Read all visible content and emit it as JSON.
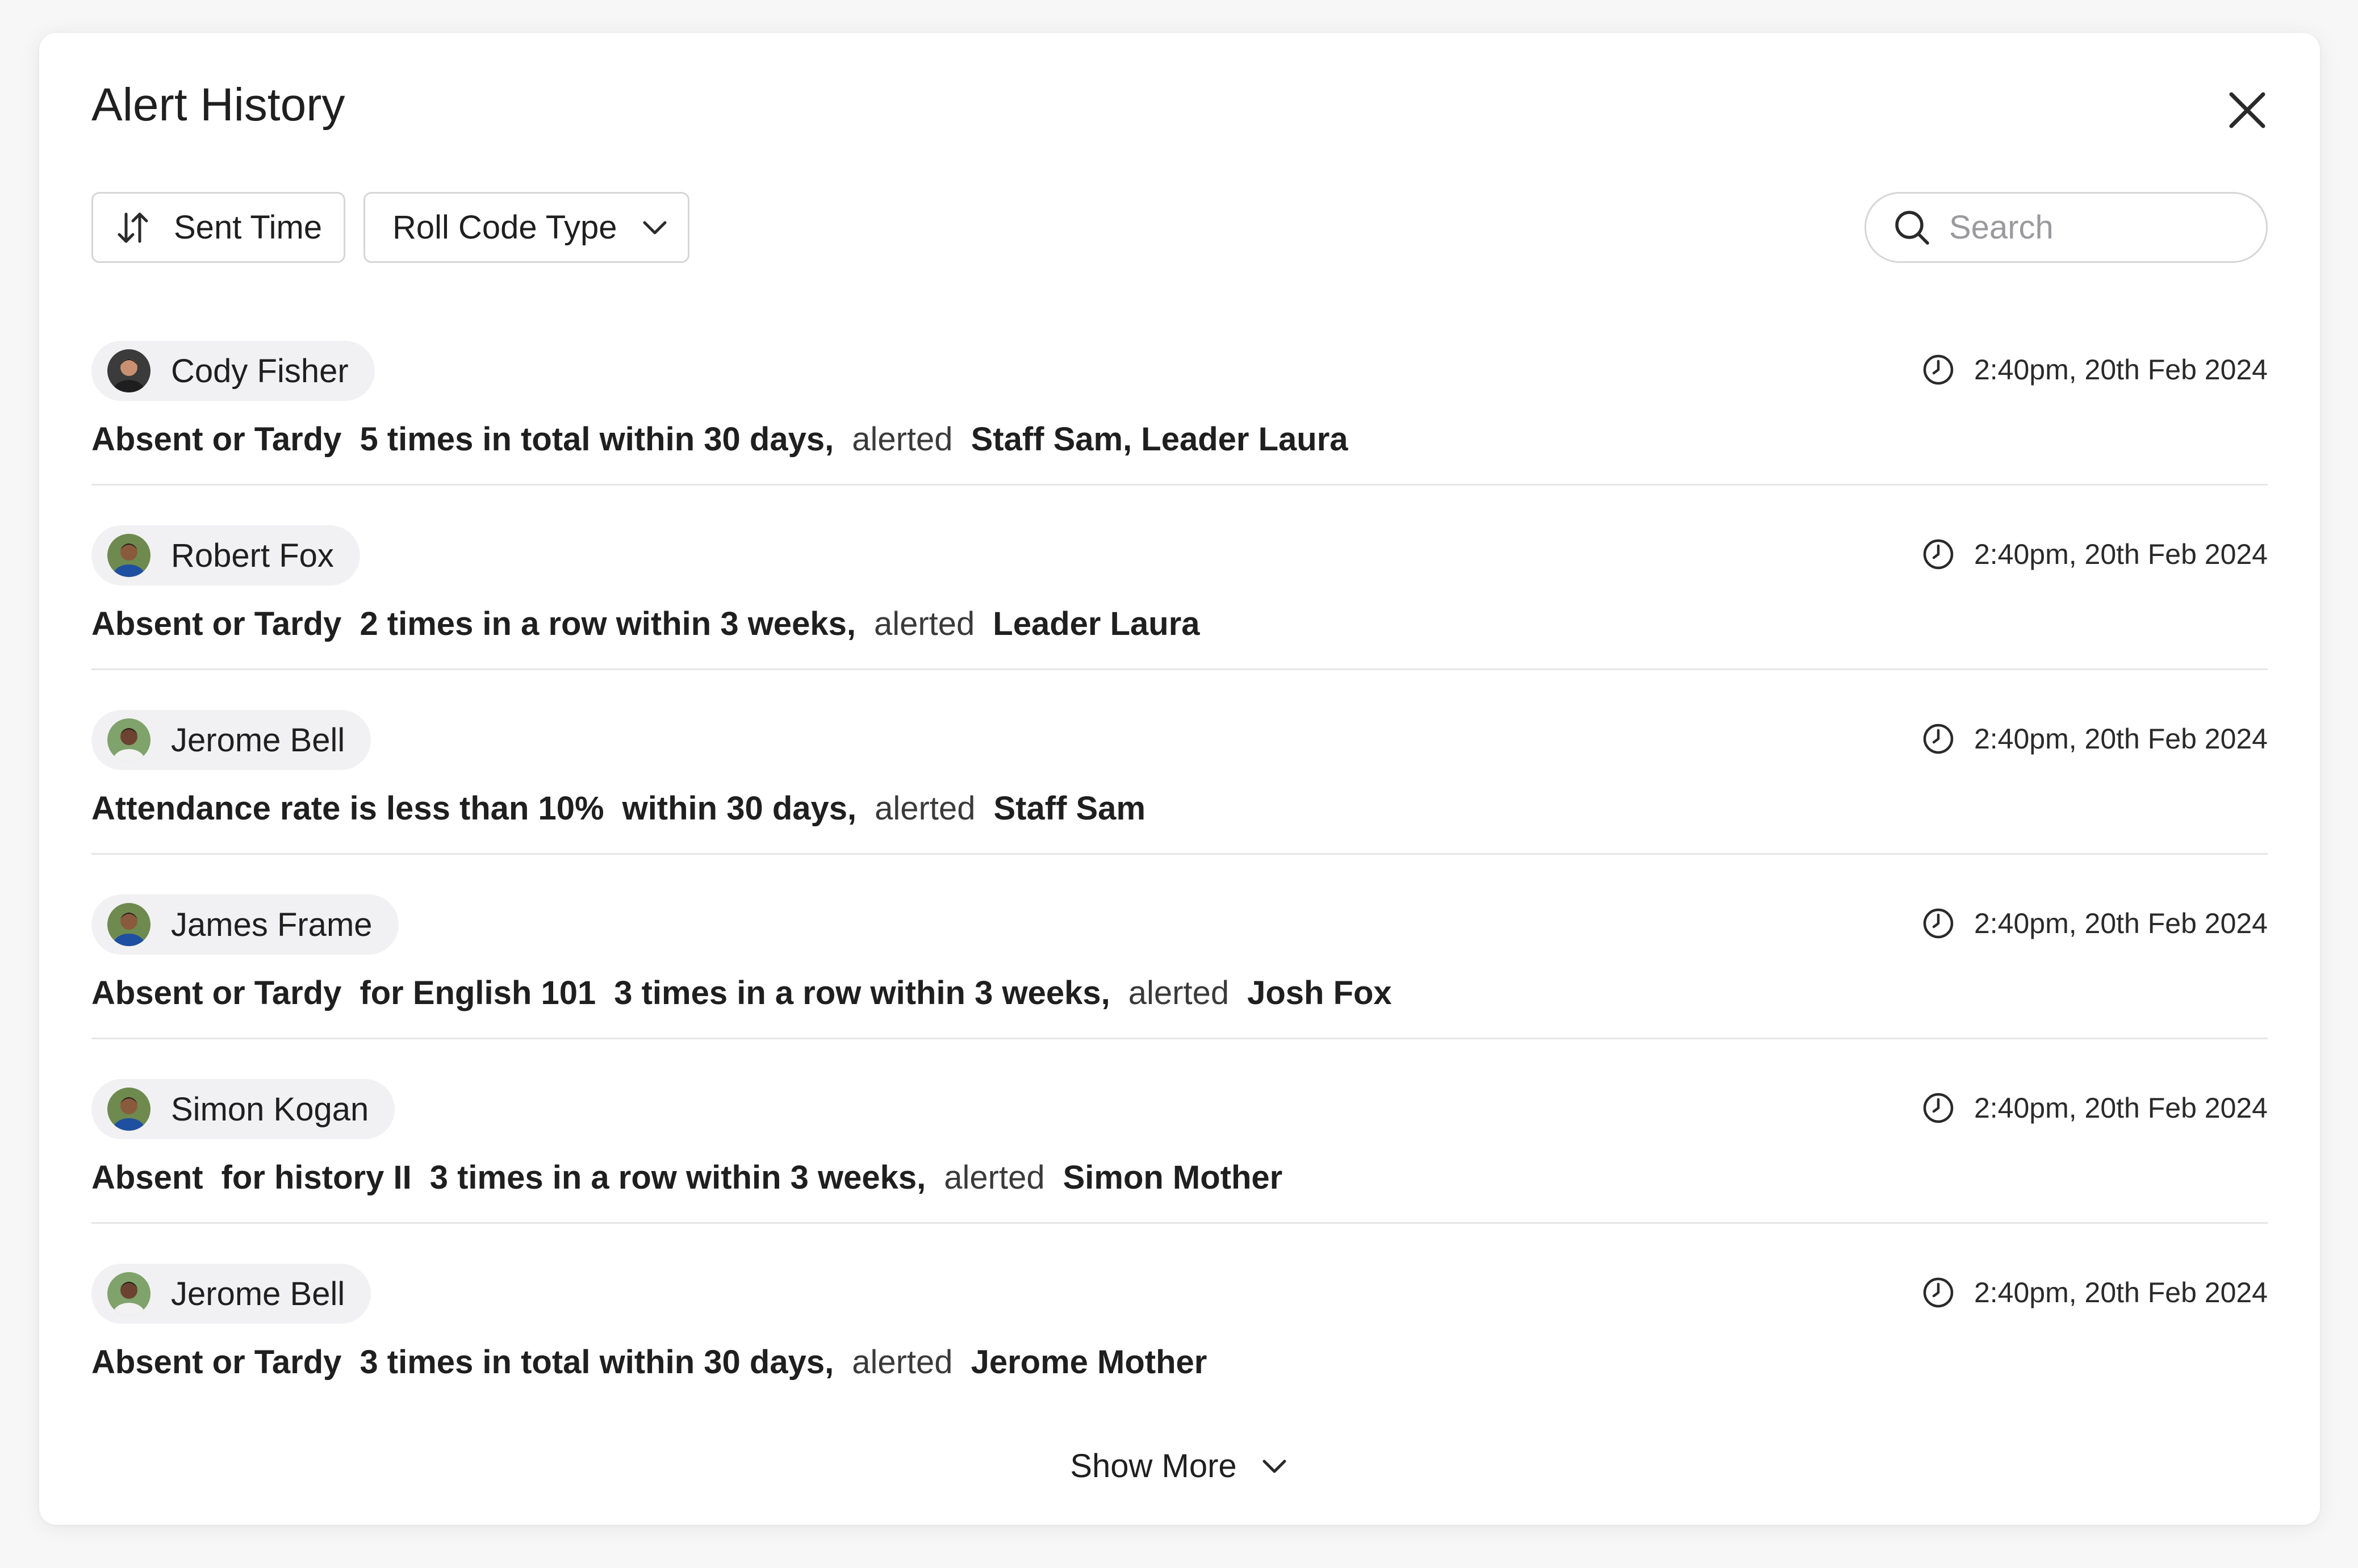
{
  "header": {
    "title": "Alert History"
  },
  "toolbar": {
    "sort_label": "Sent Time",
    "filter_label": "Roll Code Type",
    "search_placeholder": "Search"
  },
  "alerts": [
    {
      "name": "Cody Fisher",
      "time": "2:40pm, 20th Feb 2024",
      "parts": [
        {
          "t": "Absent or Tardy",
          "b": true
        },
        {
          "t": "5 times in total within 30 days,",
          "b": true
        },
        {
          "t": "alerted",
          "b": false
        },
        {
          "t": "Staff Sam, Leader Laura",
          "b": true
        }
      ],
      "avatar": {
        "bg": "#3b3b3b",
        "skin": "#c89070",
        "shirt": "#1e1e1e",
        "hair": "#1a1a1a"
      }
    },
    {
      "name": "Robert Fox",
      "time": "2:40pm, 20th Feb 2024",
      "parts": [
        {
          "t": "Absent or Tardy",
          "b": true
        },
        {
          "t": "2 times in a row within 3 weeks,",
          "b": true
        },
        {
          "t": "alerted",
          "b": false
        },
        {
          "t": "Leader Laura",
          "b": true
        }
      ],
      "avatar": {
        "bg": "#6e8a4f",
        "skin": "#8a5a3c",
        "shirt": "#1f4fa0",
        "hair": "#1b1b1b"
      }
    },
    {
      "name": "Jerome Bell",
      "time": "2:40pm, 20th Feb 2024",
      "parts": [
        {
          "t": "Attendance rate is less than 10%",
          "b": true
        },
        {
          "t": "within 30 days,",
          "b": true
        },
        {
          "t": "alerted",
          "b": false
        },
        {
          "t": "Staff Sam",
          "b": true
        }
      ],
      "avatar": {
        "bg": "#7fa36a",
        "skin": "#6b4330",
        "shirt": "#f2f2f2",
        "hair": "#1b1b1b"
      }
    },
    {
      "name": "James Frame",
      "time": "2:40pm, 20th Feb 2024",
      "parts": [
        {
          "t": "Absent or Tardy",
          "b": true
        },
        {
          "t": "for English 101",
          "b": true
        },
        {
          "t": "3 times in a row within 3 weeks,",
          "b": true
        },
        {
          "t": "alerted",
          "b": false
        },
        {
          "t": "Josh Fox",
          "b": true
        }
      ],
      "avatar": {
        "bg": "#6e8a4f",
        "skin": "#8a5a3c",
        "shirt": "#1f4fa0",
        "hair": "#1b1b1b"
      }
    },
    {
      "name": "Simon Kogan",
      "time": "2:40pm, 20th Feb 2024",
      "parts": [
        {
          "t": "Absent",
          "b": true
        },
        {
          "t": "for history II",
          "b": true
        },
        {
          "t": "3 times in a row within 3 weeks,",
          "b": true
        },
        {
          "t": "alerted",
          "b": false
        },
        {
          "t": "Simon Mother",
          "b": true
        }
      ],
      "avatar": {
        "bg": "#6e8a4f",
        "skin": "#8a5a3c",
        "shirt": "#1f4fa0",
        "hair": "#1b1b1b"
      }
    },
    {
      "name": "Jerome Bell",
      "time": "2:40pm, 20th Feb 2024",
      "parts": [
        {
          "t": "Absent or Tardy",
          "b": true
        },
        {
          "t": "3 times in total within 30 days,",
          "b": true
        },
        {
          "t": "alerted",
          "b": false
        },
        {
          "t": "Jerome Mother",
          "b": true
        }
      ],
      "avatar": {
        "bg": "#7fa36a",
        "skin": "#6b4330",
        "shirt": "#f2f2f2",
        "hair": "#1b1b1b"
      }
    }
  ],
  "footer": {
    "show_more_label": "Show More"
  },
  "icons": {
    "close": "close-icon",
    "sort": "sort-arrows-icon",
    "dropdown": "chevron-down-icon",
    "search": "search-icon",
    "clock": "clock-icon"
  }
}
